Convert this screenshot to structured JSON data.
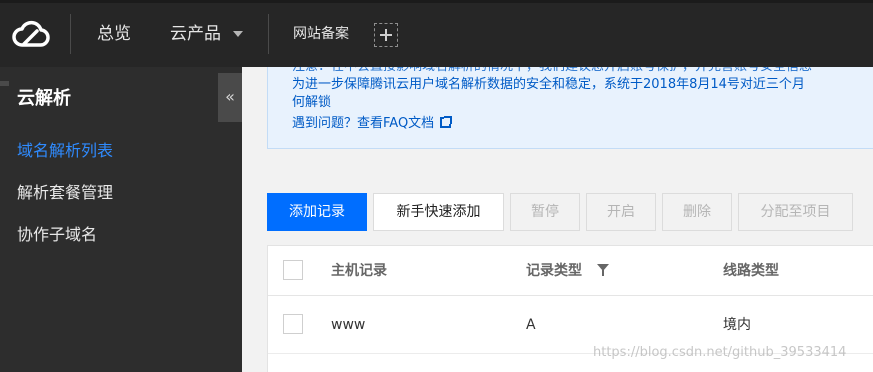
{
  "topbar": {
    "nav": {
      "overview": "总览",
      "products": "云产品",
      "icp": "网站备案"
    },
    "icons": [
      "cloud-logo-icon",
      "chevron-down-icon",
      "add-icon"
    ]
  },
  "sidebar": {
    "title": "云解析",
    "collapse_glyph": "«",
    "items": [
      {
        "label": "域名解析列表",
        "active": true
      },
      {
        "label": "解析套餐管理",
        "active": false
      },
      {
        "label": "协作子域名",
        "active": false
      }
    ]
  },
  "notice": {
    "line_cut": "注意：在不会直接影响域名解析的情况下，我们建议您开启账号保护，并完善账号安全信息",
    "line1": "为进一步保障腾讯云用户域名解析数据的安全和稳定，系统于2018年8月14号对近三个月",
    "line2": "何解锁",
    "faq": "遇到问题？查看FAQ文档"
  },
  "toolbar": {
    "add": "添加记录",
    "quick_add": "新手快速添加",
    "pause": "暂停",
    "enable": "开启",
    "delete": "删除",
    "assign": "分配至项目"
  },
  "table": {
    "columns": [
      "主机记录",
      "记录类型",
      "线路类型"
    ],
    "rows": [
      {
        "host": "www",
        "type": "A",
        "line": "境内"
      }
    ]
  },
  "watermark": "https://blog.csdn.net/github_39533414",
  "colors": {
    "accent": "#006eff",
    "topbar": "#262626",
    "sidebar": "#2d2d2d",
    "active": "#2f8bff"
  }
}
